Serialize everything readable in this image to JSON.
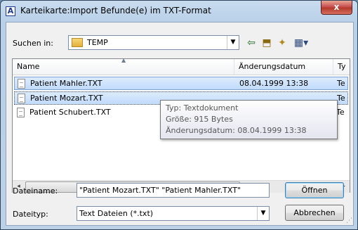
{
  "window": {
    "title": "Karteikarte:Import Befunde(e) im TXT-Format",
    "app_icon": "A",
    "close_glyph": "x"
  },
  "lookin": {
    "label": "Suchen in:",
    "value": "TEMP"
  },
  "toolbar": {
    "back_icon": "back-arrow-icon",
    "up_icon": "up-folder-icon",
    "newfolder_icon": "new-folder-icon",
    "view_icon": "view-menu-icon"
  },
  "columns": [
    "Name",
    "Änderungsdatum",
    "Ty"
  ],
  "files": [
    {
      "name": "Patient Mahler.TXT",
      "date": "08.04.1999 13:38",
      "type": "Te"
    },
    {
      "name": "Patient Mozart.TXT",
      "date": "",
      "type": "Te"
    },
    {
      "name": "Patient Schubert.TXT",
      "date": "",
      "type": "Te"
    }
  ],
  "scrollbar": {
    "left": "◂",
    "thumb": "III",
    "right": "▸"
  },
  "tooltip": {
    "type": "Typ: Textdokument",
    "size": "Größe: 915 Bytes",
    "modified": "Änderungsdatum: 08.04.1999 13:38"
  },
  "filename": {
    "label": "Dateiname:",
    "value": "\"Patient Mozart.TXT\" \"Patient Mahler.TXT\""
  },
  "filetype": {
    "label": "Dateityp:",
    "value": "Text Dateien (*.txt)"
  },
  "buttons": {
    "open": "Öffnen",
    "cancel": "Abbrechen"
  },
  "colors": {
    "selection": "#cce4fc",
    "titlebar": "#b9d1ea",
    "close": "#c75050"
  }
}
